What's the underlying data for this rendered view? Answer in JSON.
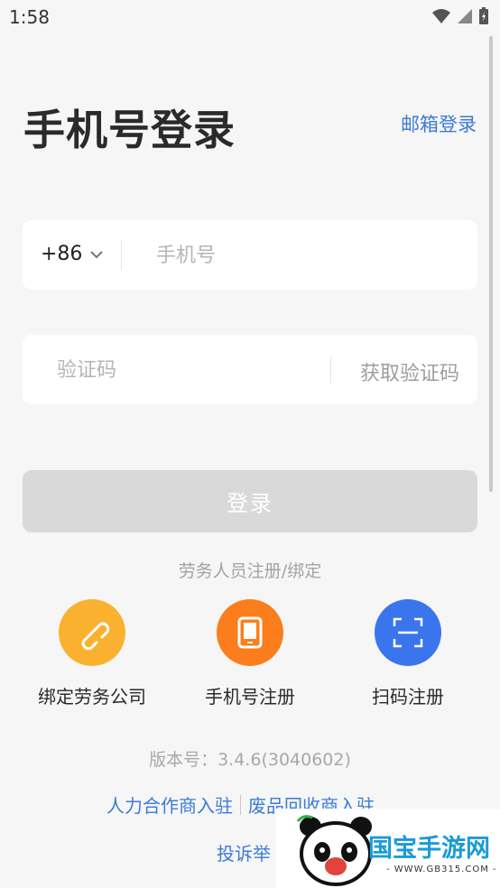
{
  "status_bar": {
    "time": "1:58"
  },
  "header": {
    "title": "手机号登录",
    "email_login": "邮箱登录"
  },
  "phone_field": {
    "country_code": "+86",
    "placeholder": "手机号"
  },
  "code_field": {
    "placeholder": "验证码",
    "get_code": "获取验证码"
  },
  "login_button": {
    "label": "登录"
  },
  "register": {
    "title": "劳务人员注册/绑定",
    "actions": [
      {
        "label": "绑定劳务公司",
        "icon": "link-icon",
        "color": "#fbb130"
      },
      {
        "label": "手机号注册",
        "icon": "phone-icon",
        "color": "#fb7d1c"
      },
      {
        "label": "扫码注册",
        "icon": "scan-icon",
        "color": "#3b75ee"
      }
    ]
  },
  "footer": {
    "version": "版本号：3.4.6(3040602)",
    "link_partner": "人力合作商入驻",
    "link_recycle": "废品回收商入驻",
    "link_complaint": "投诉举"
  },
  "watermark": {
    "text": "国宝手游网",
    "url": "- WWW.GB315.COM -"
  }
}
